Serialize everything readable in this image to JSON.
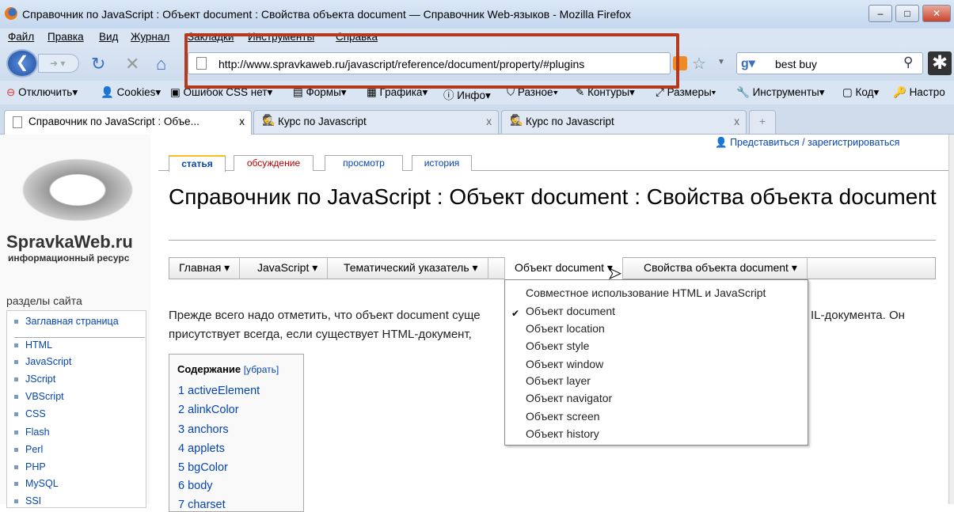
{
  "window": {
    "title": "Справочник по JavaScript : Объект document : Свойства объекта document — Справочник Web-языков - Mozilla Firefox",
    "min": "–",
    "max": "□",
    "close": "✕"
  },
  "menu": [
    "Файл",
    "Правка",
    "Вид",
    "Журнал",
    "Закладки",
    "Инструменты",
    "Справка"
  ],
  "nav": {
    "url": "http://www.spravkaweb.ru/javascript/reference/document/property/#plugins",
    "search_value": "best buy"
  },
  "bookmarks": [
    "Отключить",
    "Cookies",
    "Ошибок CSS нет",
    "Формы",
    "Графика",
    "Инфо",
    "Разное",
    "Контуры",
    "Размеры",
    "Инструменты",
    "Код",
    "Настро"
  ],
  "tabs": [
    {
      "label": "Справочник по JavaScript : Объе...",
      "close": "x"
    },
    {
      "label": "Курс по Javascript",
      "close": "x"
    },
    {
      "label": "Курс по Javascript",
      "close": "x"
    }
  ],
  "new_tab": "+",
  "page": {
    "login": "Представиться / зарегистрироваться",
    "logo_name": "SpravkaWeb.ru",
    "logo_sub": "информационный ресурс",
    "sections_title": "разделы сайта",
    "sections": [
      "Заглавная страница",
      "HTML",
      "JavaScript",
      "JScript",
      "VBScript",
      "CSS",
      "Flash",
      "Perl",
      "PHP",
      "MySQL",
      "SSI"
    ],
    "page_tabs": [
      "статья",
      "обсуждение",
      "просмотр",
      "история"
    ],
    "heading": "Справочник по JavaScript : Объект document : Свойства объекта document",
    "menubar": [
      "Главная ▾",
      "JavaScript ▾",
      "Тематический указатель ▾",
      "Объект document ▾",
      "Свойства объекта document ▾"
    ],
    "dropdown": [
      "Совместное использование HTML и JavaScript",
      "Объект document",
      "Объект location",
      "Объект style",
      "Объект window",
      "Объект layer",
      "Объект navigator",
      "Объект screen",
      "Объект history"
    ],
    "dropdown_checked": "Объект document",
    "para1_a": "Прежде всего надо отметить, что объект document суще",
    "para1_b": "IL-документа. Он",
    "para2": "присутствует всегда, если существует HTML-документ,",
    "toc_title": "Содержание",
    "toc_hide": "[убрать]",
    "toc": [
      "1 activeElement",
      "2 alinkColor",
      "3 anchors",
      "4 applets",
      "5 bgColor",
      "6 body",
      "7 charset"
    ]
  }
}
